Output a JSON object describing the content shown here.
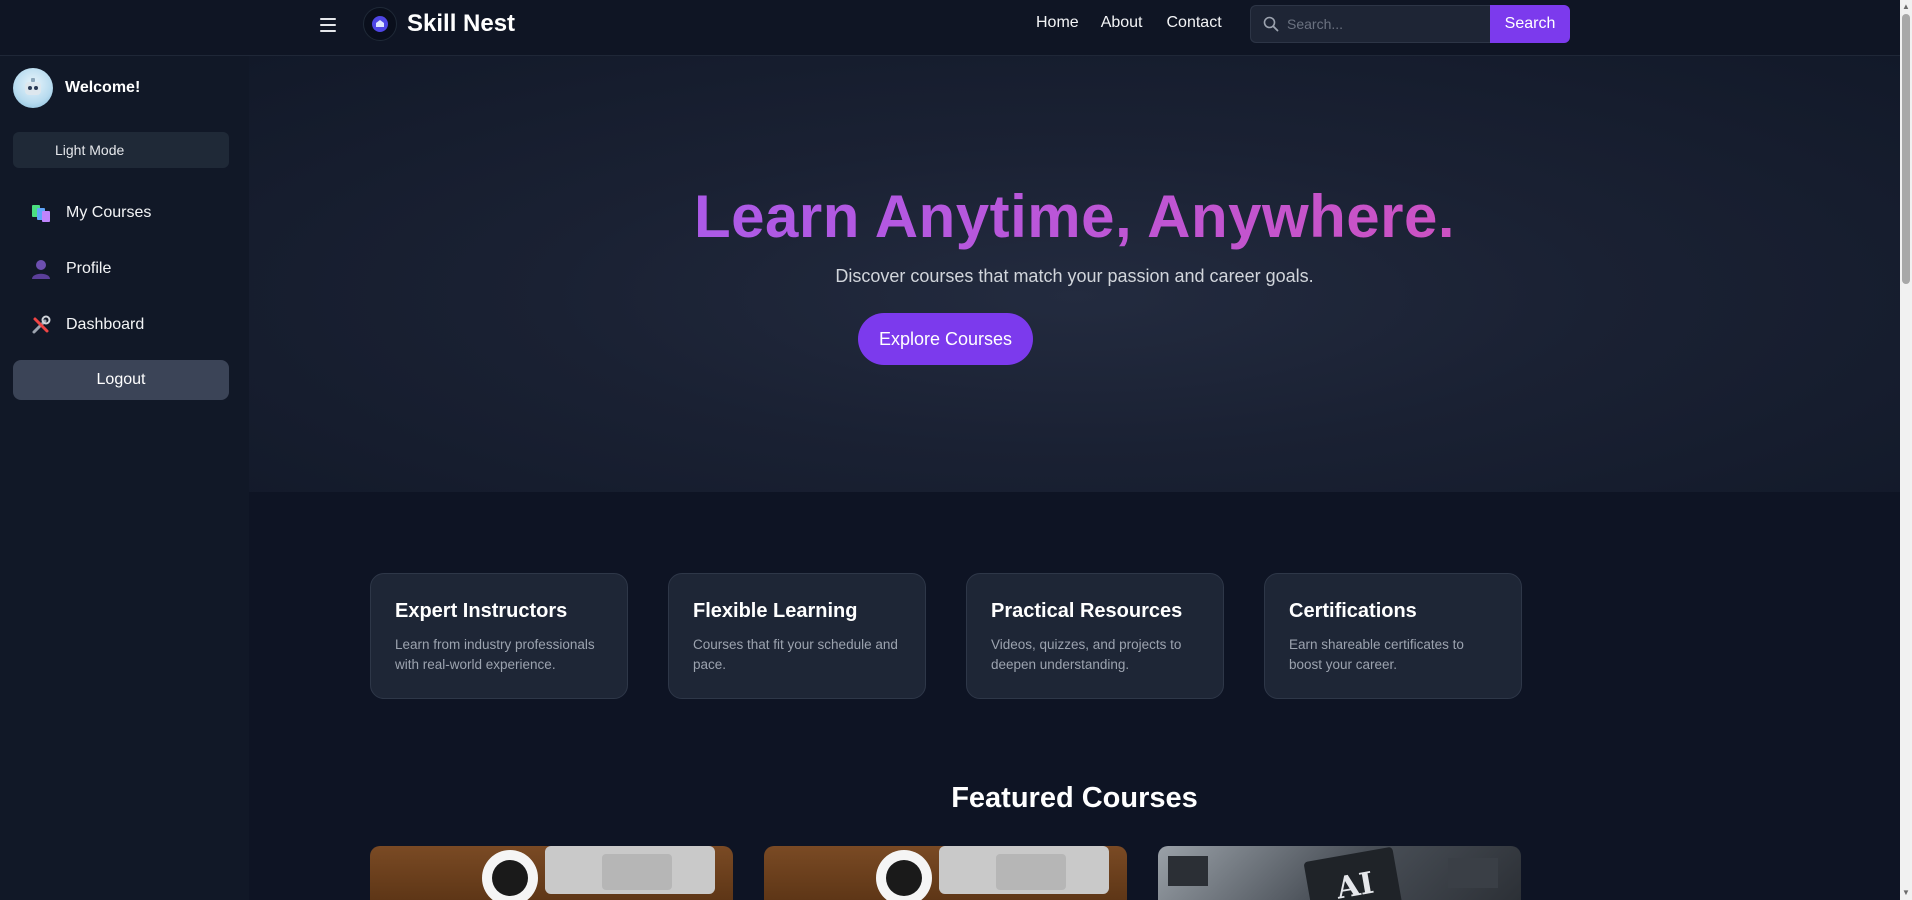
{
  "navbar": {
    "brand": "Skill Nest",
    "links": [
      "Home",
      "About",
      "Contact"
    ],
    "search_placeholder": "Search...",
    "search_button": "Search"
  },
  "sidebar": {
    "welcome": "Welcome!",
    "mode_toggle": "Light Mode",
    "items": [
      {
        "label": "My Courses",
        "icon": "books-icon"
      },
      {
        "label": "Profile",
        "icon": "user-icon"
      },
      {
        "label": "Dashboard",
        "icon": "tools-icon"
      }
    ],
    "logout": "Logout"
  },
  "hero": {
    "title": "Learn Anytime, Anywhere.",
    "subtitle": "Discover courses that match your passion and career goals.",
    "cta": "Explore Courses"
  },
  "features": [
    {
      "title": "Expert Instructors",
      "text": "Learn from industry professionals with real-world experience."
    },
    {
      "title": "Flexible Learning",
      "text": "Courses that fit your schedule and pace."
    },
    {
      "title": "Practical Resources",
      "text": "Videos, quizzes, and projects to deepen understanding."
    },
    {
      "title": "Certifications",
      "text": "Earn shareable certificates to boost your career."
    }
  ],
  "featured": {
    "title": "Featured Courses",
    "thumb_chip_text": "AI"
  },
  "colors": {
    "accent": "#7c3aed",
    "background": "#0e1424",
    "sidebar": "#111827",
    "gradient_start": "#9b5ef6",
    "gradient_end": "#e04dab"
  }
}
